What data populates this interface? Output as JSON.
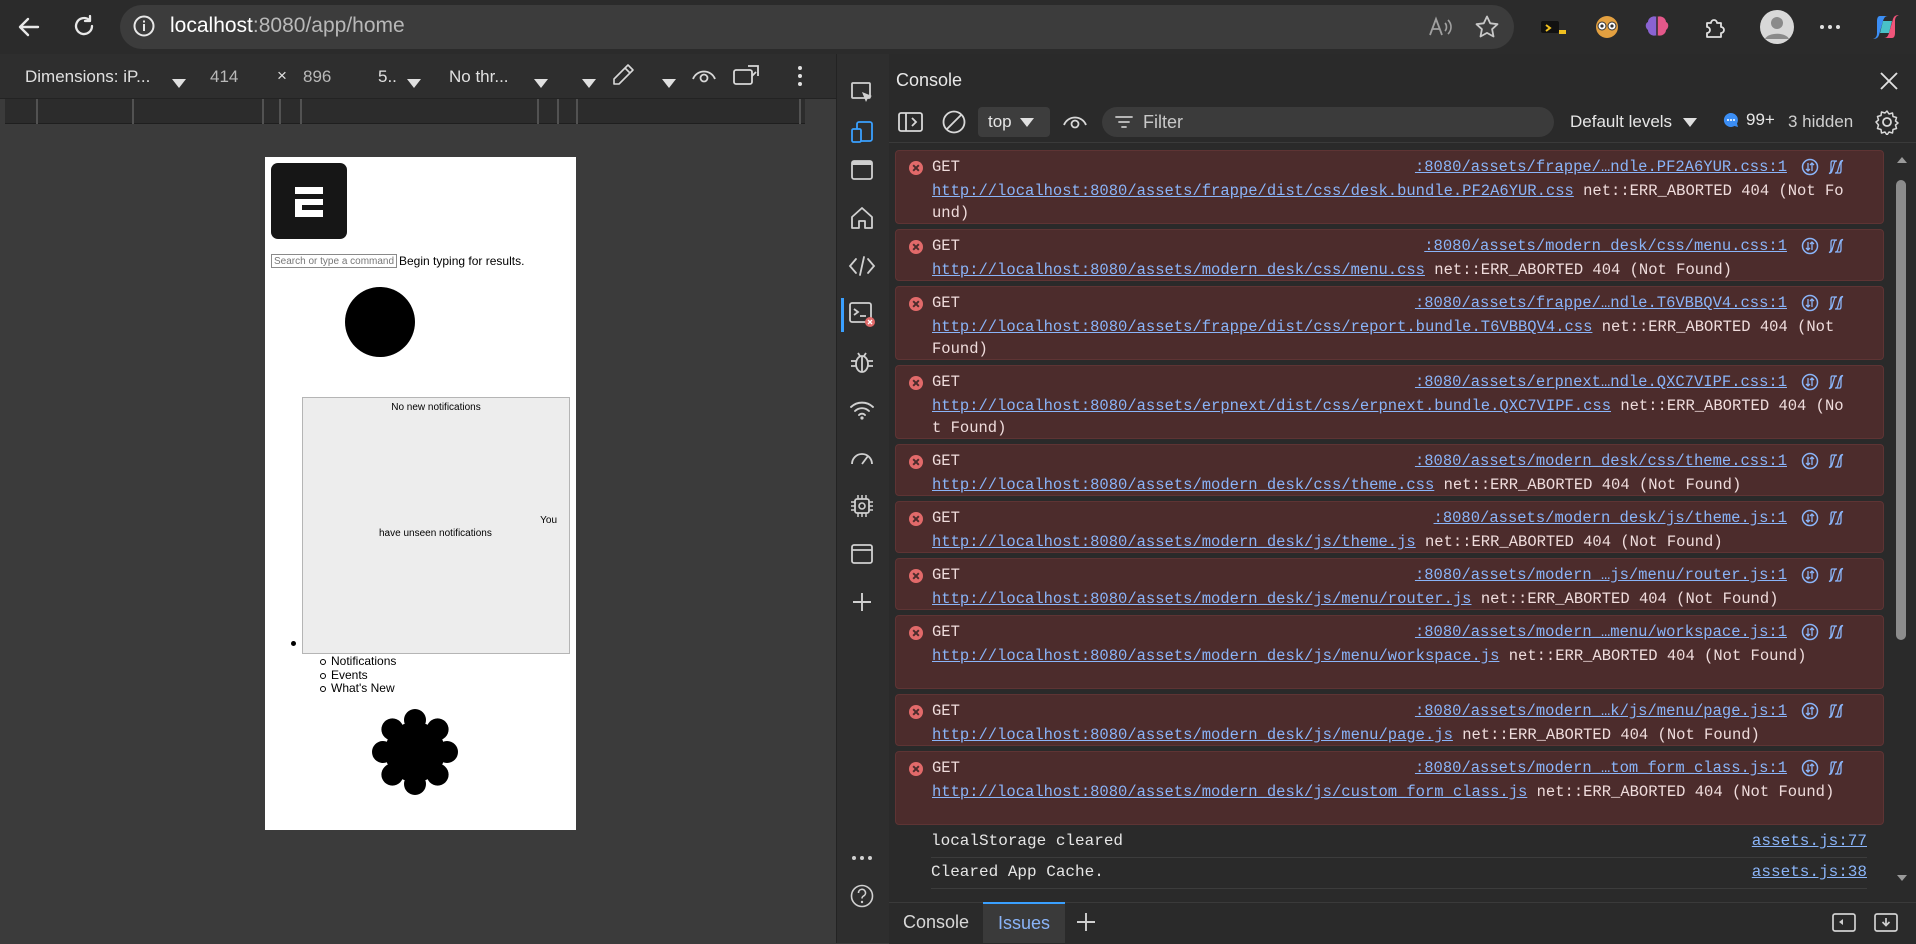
{
  "browser": {
    "address_host": "localhost",
    "address_path": ":8080/app/home"
  },
  "device_toolbar": {
    "dimensions_label": "Dimensions: iP...",
    "width": "414",
    "times": "×",
    "height": "896",
    "zoom": "5..",
    "throttle": "No thr..."
  },
  "page": {
    "search_placeholder": "Search or type a command",
    "search_hint": "Begin typing for results.",
    "notifications_empty": "No new notifications",
    "notifications_you": "You",
    "notifications_unseen": "have unseen notifications",
    "menu_items": [
      "Notifications",
      "Events",
      "What's New"
    ]
  },
  "console": {
    "title": "Console",
    "context": "top",
    "filter_placeholder": "Filter",
    "levels": "Default levels",
    "issues_count": "99+",
    "hidden": "3 hidden",
    "errors": [
      {
        "method": "GET",
        "source": ":8080/assets/frappe/…ndle.PF2A6YUR.css:1",
        "url": "http://localhost:8080/assets/frappe/dist/css/desk.bundle.PF2A6YUR.css",
        "message": "net::ERR_ABORTED 404 (Not Found)"
      },
      {
        "method": "GET",
        "source": ":8080/assets/modern_desk/css/menu.css:1",
        "url": "http://localhost:8080/assets/modern_desk/css/menu.css",
        "message": "net::ERR_ABORTED 404 (Not Found)"
      },
      {
        "method": "GET",
        "source": ":8080/assets/frappe/…ndle.T6VBBQV4.css:1",
        "url": "http://localhost:8080/assets/frappe/dist/css/report.bundle.T6VBBQV4.css",
        "message": "net::ERR_ABORTED 404 (Not Found)"
      },
      {
        "method": "GET",
        "source": ":8080/assets/erpnext…ndle.QXC7VIPF.css:1",
        "url": "http://localhost:8080/assets/erpnext/dist/css/erpnext.bundle.QXC7VIPF.css",
        "message": "net::ERR_ABORTED 404 (Not Found)"
      },
      {
        "method": "GET",
        "source": ":8080/assets/modern_desk/css/theme.css:1",
        "url": "http://localhost:8080/assets/modern_desk/css/theme.css",
        "message": "net::ERR_ABORTED 404 (Not Found)"
      },
      {
        "method": "GET",
        "source": ":8080/assets/modern_desk/js/theme.js:1",
        "url": "http://localhost:8080/assets/modern_desk/js/theme.js",
        "message": "net::ERR_ABORTED 404 (Not Found)"
      },
      {
        "method": "GET",
        "source": ":8080/assets/modern_…js/menu/router.js:1",
        "url": "http://localhost:8080/assets/modern_desk/js/menu/router.js",
        "message": "net::ERR_ABORTED 404 (Not Found)"
      },
      {
        "method": "GET",
        "source": ":8080/assets/modern_…menu/workspace.js:1",
        "url": "http://localhost:8080/assets/modern_desk/js/menu/workspace.js",
        "message": "net::ERR_ABORTED 404 (Not Found)"
      },
      {
        "method": "GET",
        "source": ":8080/assets/modern_…k/js/menu/page.js:1",
        "url": "http://localhost:8080/assets/modern_desk/js/menu/page.js",
        "message": "net::ERR_ABORTED 404 (Not Found)"
      },
      {
        "method": "GET",
        "source": ":8080/assets/modern_…tom_form_class.js:1",
        "url": "http://localhost:8080/assets/modern_desk/js/custom_form_class.js",
        "message": "net::ERR_ABORTED 404 (Not Found)"
      }
    ],
    "info_logs": [
      {
        "text": "localStorage cleared",
        "source": "assets.js:77"
      },
      {
        "text": "Cleared App Cache.",
        "source": "assets.js:38"
      }
    ]
  },
  "drawer": {
    "tabs": [
      "Console",
      "Issues"
    ]
  },
  "colors": {
    "accent": "#3aa0ff",
    "error_bg": "#4c2c2c",
    "link": "#8ab4f8"
  }
}
